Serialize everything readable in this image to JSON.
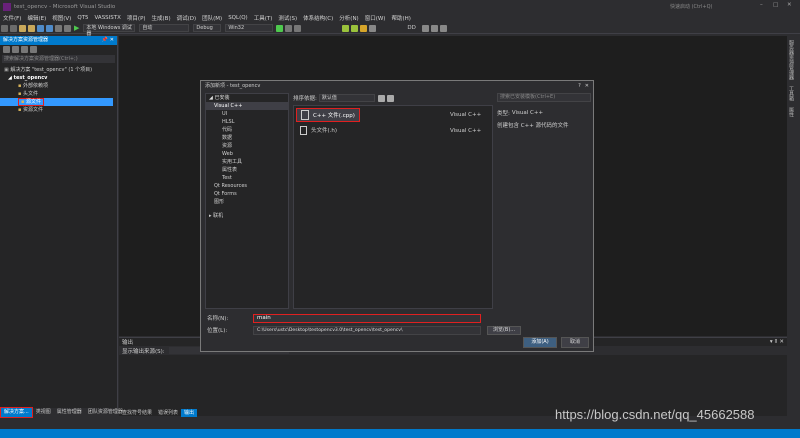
{
  "window": {
    "title": "test_opencv - Microsoft Visual Studio",
    "quick_launch": "快速启动 (Ctrl+Q)"
  },
  "menu": [
    "文件(F)",
    "编辑(E)",
    "视图(V)",
    "QT5",
    "VASSISTX",
    "项目(P)",
    "生成(B)",
    "调试(D)",
    "团队(M)",
    "SQL(Q)",
    "工具(T)",
    "测试(S)",
    "体系结构(C)",
    "分析(N)",
    "窗口(W)",
    "帮助(H)"
  ],
  "toolbar": {
    "debugger": "本地 Windows 调试器",
    "config_auto": "自动",
    "config": "Debug",
    "platform": "Win32",
    "dd": "DD"
  },
  "solution_explorer": {
    "header": "解决方案资源管理器",
    "search_placeholder": "搜索解决方案资源管理器(Ctrl+;)",
    "solution_label": "解决方案 \"test_opencv\" (1 个项目)",
    "project": "test_opencv",
    "items": [
      "外部依赖项",
      "头文件",
      "源文件",
      "资源文件"
    ]
  },
  "dialog": {
    "title": "添加新项 - test_opencv",
    "installed": "已安装",
    "categories": [
      "Visual C++",
      "UI",
      "HLSL",
      "代码",
      "数据",
      "资源",
      "Web",
      "实用工具",
      "属性表",
      "Test",
      "Qt Resources",
      "Qt Forms",
      "图形"
    ],
    "online": "联机",
    "sort_label": "排序依据:",
    "sort_value": "默认值",
    "search_placeholder": "搜索已安装模板(Ctrl+E)",
    "templates": [
      {
        "name": "C++ 文件(.cpp)",
        "lang": "Visual C++"
      },
      {
        "name": "头文件(.h)",
        "lang": "Visual C++"
      }
    ],
    "info_type_label": "类型:",
    "info_type": "Visual C++",
    "info_desc": "创建包含 C++ 源代码的文件",
    "name_label": "名称(N):",
    "name_value": "main",
    "location_label": "位置(L):",
    "location_value": "C:\\Users\\ustc\\Desktop\\testopencv3.0\\test_opencv\\test_opencv\\",
    "browse": "浏览(B)...",
    "add": "添加(A)",
    "cancel": "取消"
  },
  "output": {
    "title": "输出",
    "source_label": "显示输出来源(S):"
  },
  "bottom_tabs": [
    "解决方案...",
    "类视图",
    "属性管理器",
    "团队资源管理器"
  ],
  "center_tabs": [
    "查找符号结果",
    "错误列表",
    "输出"
  ],
  "right_tabs": [
    "服务器资源管理器",
    "工具箱",
    "属性"
  ],
  "watermark": "https://blog.csdn.net/qq_45662588"
}
